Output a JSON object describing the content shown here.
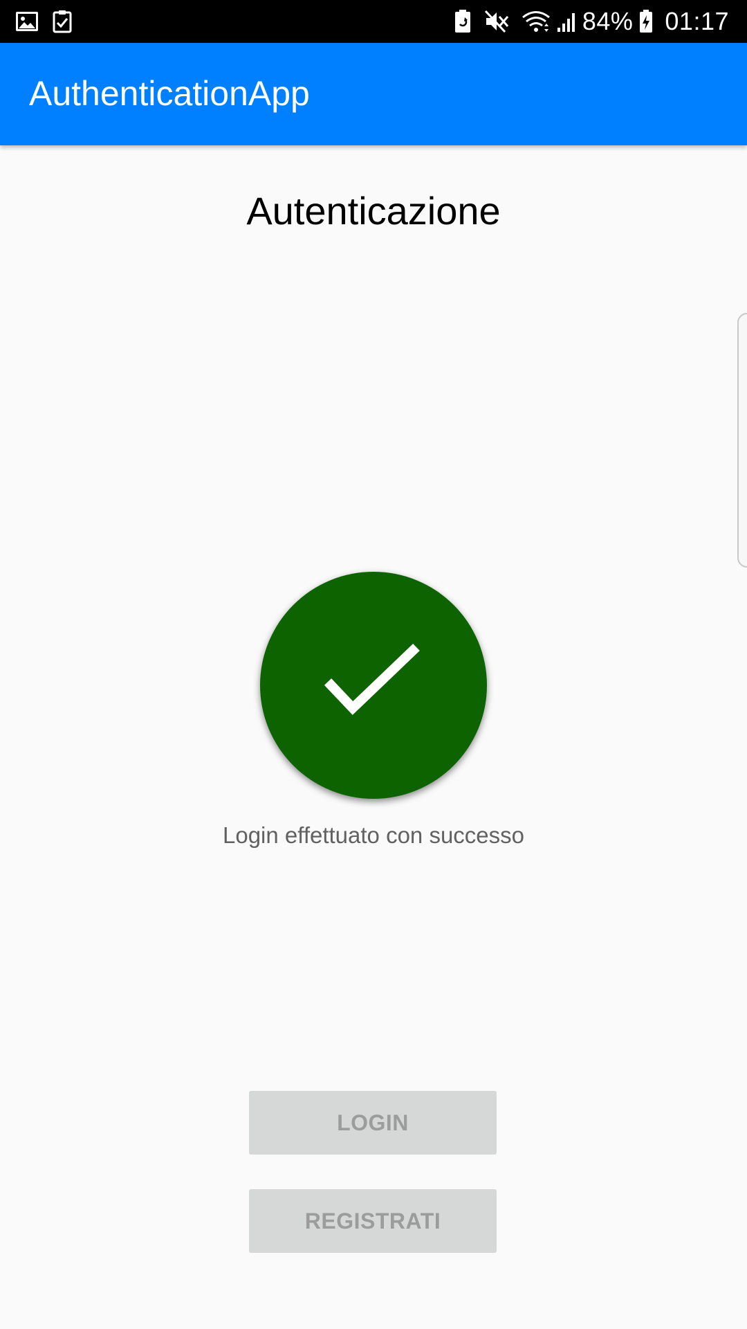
{
  "status_bar": {
    "left_icons": [
      "gallery-icon",
      "clipboard-check-icon"
    ],
    "right_icons": [
      "battery-saver-icon",
      "mute-icon",
      "wifi-icon",
      "signal-icon",
      "battery-icon"
    ],
    "battery_percent": "84%",
    "time": "01:17"
  },
  "app_bar": {
    "title": "AuthenticationApp",
    "color": "#0080ff"
  },
  "content": {
    "heading": "Autenticazione",
    "success_icon": "checkmark-icon",
    "success_color": "#0d6300",
    "message": "Login effettuato con successo"
  },
  "buttons": {
    "login_label": "LOGIN",
    "register_label": "REGISTRATI"
  }
}
